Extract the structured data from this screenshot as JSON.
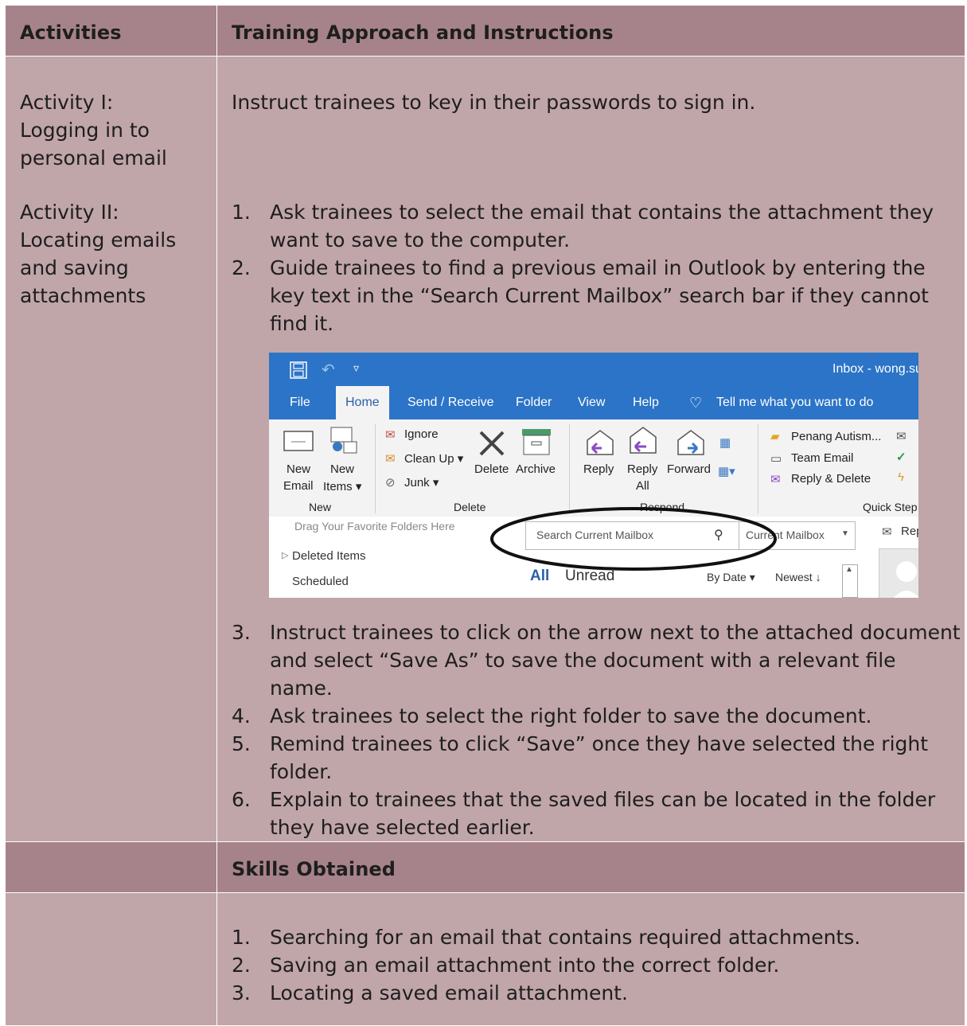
{
  "header": {
    "col1": "Activities",
    "col2": "Training Approach and Instructions"
  },
  "activity1": {
    "label_lines": [
      "Activity I:",
      "Logging in to",
      "personal email"
    ],
    "instruction": "Instruct trainees to key in their passwords to sign in."
  },
  "activity2": {
    "label_lines": [
      "Activity II:",
      "Locating emails",
      "and saving",
      "attachments"
    ],
    "steps_before": [
      {
        "num": "1.",
        "text": "Ask trainees to select the email that contains the attachment they want to save to the computer."
      },
      {
        "num": "2.",
        "text": "Guide trainees to find a previous email in Outlook by entering the key text in the “Search Current Mailbox” search bar if they cannot find it."
      }
    ],
    "steps_after": [
      {
        "num": "3.",
        "text": "Instruct trainees to click on the arrow next to the attached document and select “Save As” to save the document with a relevant file name."
      },
      {
        "num": "4.",
        "text": "Ask trainees to select the right folder to save the document."
      },
      {
        "num": "5.",
        "text": "Remind trainees to click “Save” once they have selected the right folder."
      },
      {
        "num": "6.",
        "text": "Explain to trainees that the saved files can be located in the folder they have selected earlier."
      }
    ]
  },
  "outlook": {
    "title": "Inbox - wong.su",
    "tabs": [
      "File",
      "Home",
      "Send / Receive",
      "Folder",
      "View",
      "Help"
    ],
    "tell_me": "Tell me what you want to do",
    "buttons": {
      "new_email": [
        "New",
        "Email"
      ],
      "new_items": [
        "New",
        "Items ▾"
      ],
      "ignore": "Ignore",
      "clean_up": "Clean Up ▾",
      "junk": "Junk ▾",
      "delete": "Delete",
      "archive": "Archive",
      "reply": "Reply",
      "reply_all": [
        "Reply",
        "All"
      ],
      "forward": "Forward",
      "qs1": "Penang Autism...",
      "qs2": "Team Email",
      "qs3": "Reply & Delete"
    },
    "groups": {
      "new": "New",
      "delete": "Delete",
      "respond": "Respond",
      "quick_steps": "Quick Step"
    },
    "folders": {
      "drag": "Drag Your Favorite Folders Here",
      "deleted": "Deleted Items",
      "scheduled": "Scheduled"
    },
    "search": {
      "placeholder": "Search Current Mailbox",
      "scope": "Current Mailbox"
    },
    "filters": {
      "all": "All",
      "unread": "Unread",
      "by_date": "By Date ▾",
      "newest": "Newest ↓"
    },
    "reading_pane": "Rep"
  },
  "skills": {
    "header": "Skills Obtained",
    "items": [
      {
        "num": "1.",
        "text": "Searching for an email that contains required attachments."
      },
      {
        "num": "2.",
        "text": "Saving an email attachment into the correct folder."
      },
      {
        "num": "3.",
        "text": "Locating a saved email attachment."
      }
    ]
  }
}
